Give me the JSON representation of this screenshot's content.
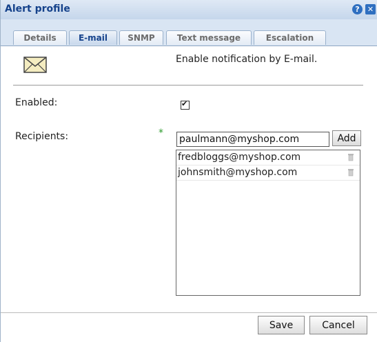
{
  "window": {
    "title": "Alert profile"
  },
  "tabs": [
    {
      "label": "Details",
      "active": false
    },
    {
      "label": "E-mail",
      "active": true
    },
    {
      "label": "SNMP",
      "active": false
    },
    {
      "label": "Text message",
      "active": false
    },
    {
      "label": "Escalation",
      "active": false
    }
  ],
  "email_panel": {
    "description": "Enable notification by E-mail.",
    "enabled_label": "Enabled:",
    "enabled_checked": true,
    "recipients_label": "Recipients:",
    "required_marker": "*",
    "new_recipient_value": "paulmann@myshop.com",
    "add_label": "Add",
    "recipients": [
      "fredbloggs@myshop.com",
      "johnsmith@myshop.com"
    ]
  },
  "footer": {
    "save_label": "Save",
    "cancel_label": "Cancel"
  },
  "icons": {
    "help": "help-icon",
    "close": "close-icon",
    "envelope": "envelope-icon",
    "delete": "trash-icon"
  },
  "colors": {
    "title_text": "#15428b",
    "header_bg": "#d9e5f3",
    "required_star": "#2a9a2a"
  }
}
